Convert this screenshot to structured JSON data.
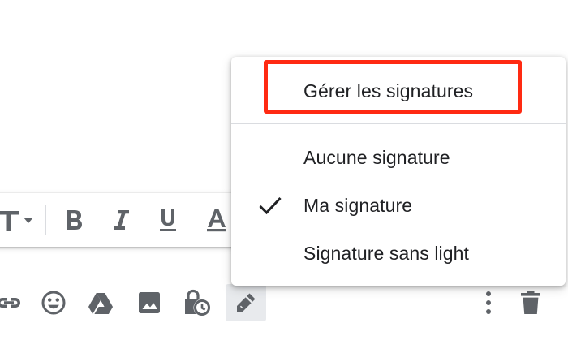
{
  "signature_menu": {
    "manage_label": "Gérer les signatures",
    "options": [
      {
        "label": "Aucune signature",
        "selected": false
      },
      {
        "label": "Ma signature",
        "selected": true
      },
      {
        "label": "Signature sans light",
        "selected": false
      }
    ],
    "highlight_color": "#ff2a12"
  },
  "format_toolbar": {
    "font_size_icon": "text-size-icon",
    "buttons": [
      "bold-icon",
      "italic-icon",
      "underline-icon",
      "text-color-icon"
    ]
  },
  "compose_toolbar": {
    "buttons": [
      "link-icon",
      "emoji-icon",
      "drive-icon",
      "image-icon",
      "confidential-icon",
      "signature-pen-icon",
      "more-options-icon",
      "trash-icon"
    ]
  },
  "colors": {
    "icon_gray": "#5f6368",
    "text": "#202124",
    "active_bg": "#e8eaed"
  }
}
